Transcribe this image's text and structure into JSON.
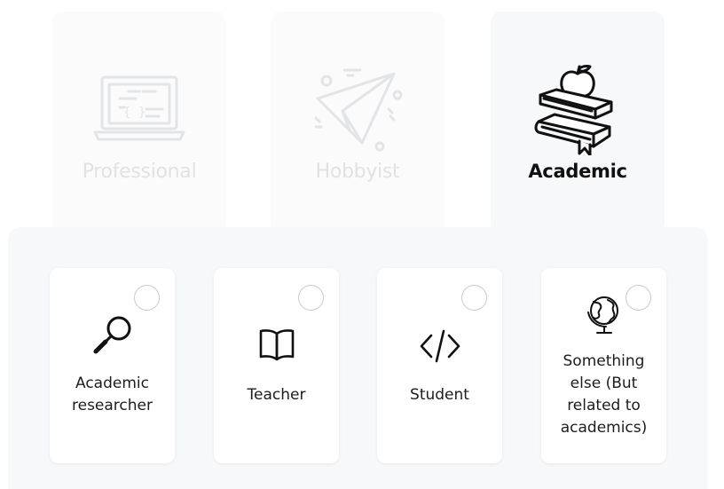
{
  "categories": [
    {
      "label": "Professional",
      "icon": "laptop-code-icon",
      "active": false
    },
    {
      "label": "Hobbyist",
      "icon": "paper-plane-icon",
      "active": false
    },
    {
      "label": "Academic",
      "icon": "books-apple-icon",
      "active": true
    }
  ],
  "options": [
    {
      "label": "Academic researcher",
      "icon": "magnifying-glass-icon",
      "selected": false
    },
    {
      "label": "Teacher",
      "icon": "open-book-icon",
      "selected": false
    },
    {
      "label": "Student",
      "icon": "code-brackets-icon",
      "selected": false
    },
    {
      "label": "Something else (But related to academics)",
      "icon": "globe-icon",
      "selected": false
    }
  ],
  "colors": {
    "inactive_text": "#e0e2e5",
    "active_text": "#111111",
    "panel_bg": "#f7f8f9",
    "radio_border": "#c9ccd0"
  }
}
